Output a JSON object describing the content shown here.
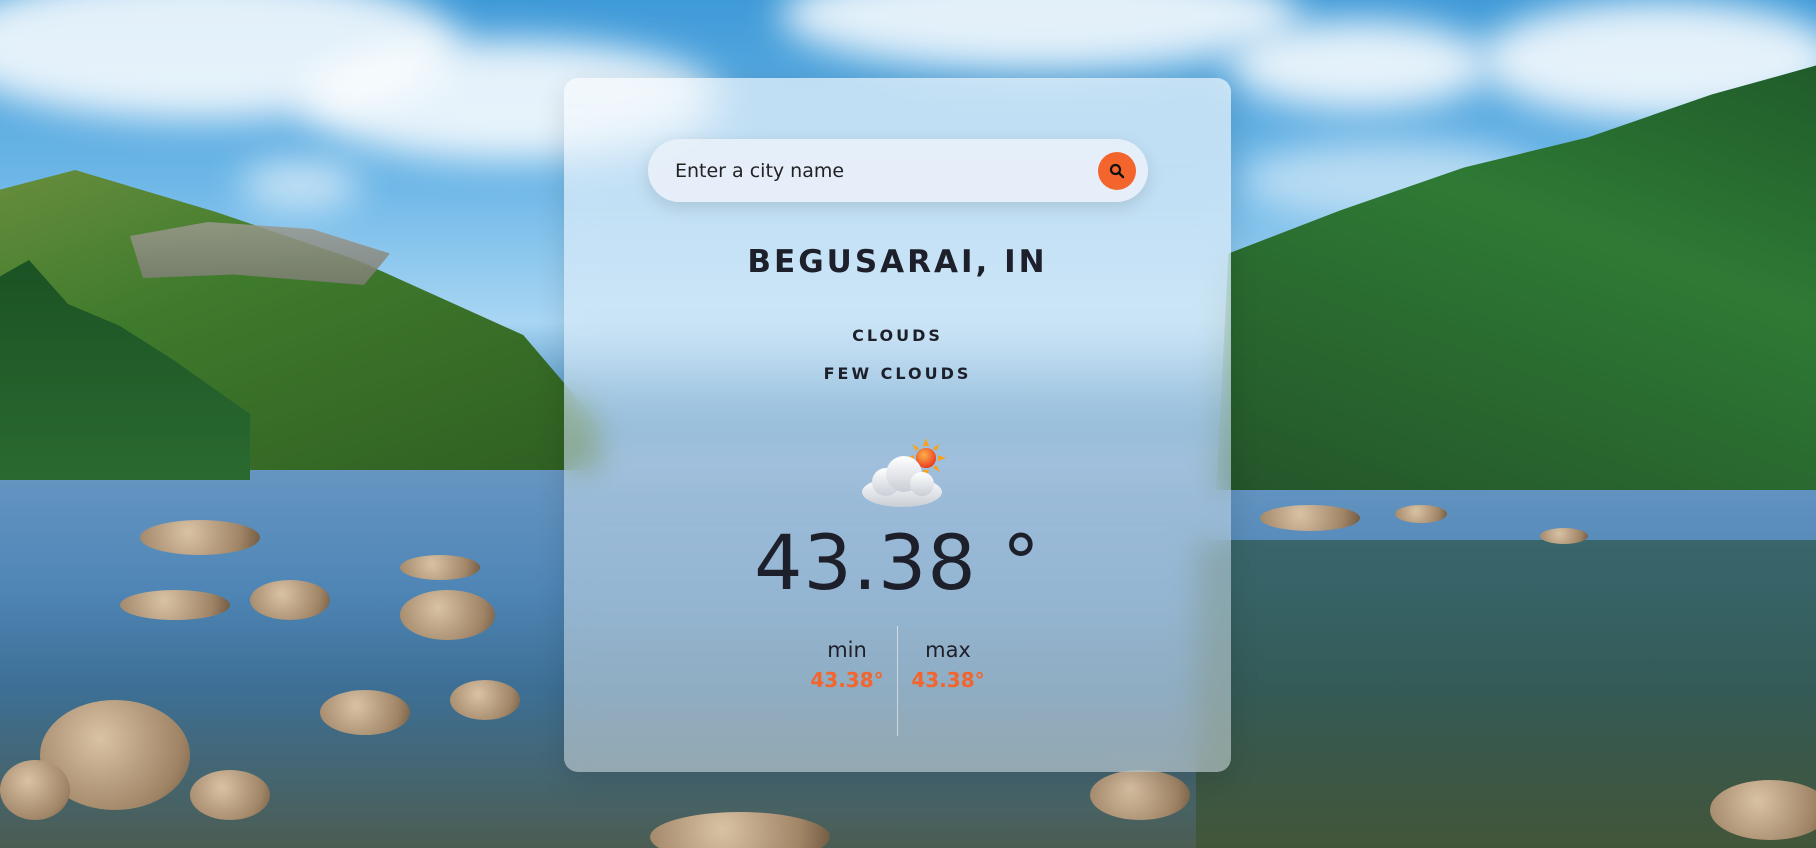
{
  "search": {
    "placeholder": "Enter a city name"
  },
  "weather": {
    "city": "BEGUSARAI, IN",
    "main": "CLOUDS",
    "description": "FEW CLOUDS",
    "icon": "few-clouds-icon",
    "temperature": "43.38 °",
    "min_label": "min",
    "min_value": "43.38°",
    "max_label": "max",
    "max_value": "43.38°"
  },
  "colors": {
    "accent": "#f4652e",
    "text": "#1d1f2a"
  }
}
